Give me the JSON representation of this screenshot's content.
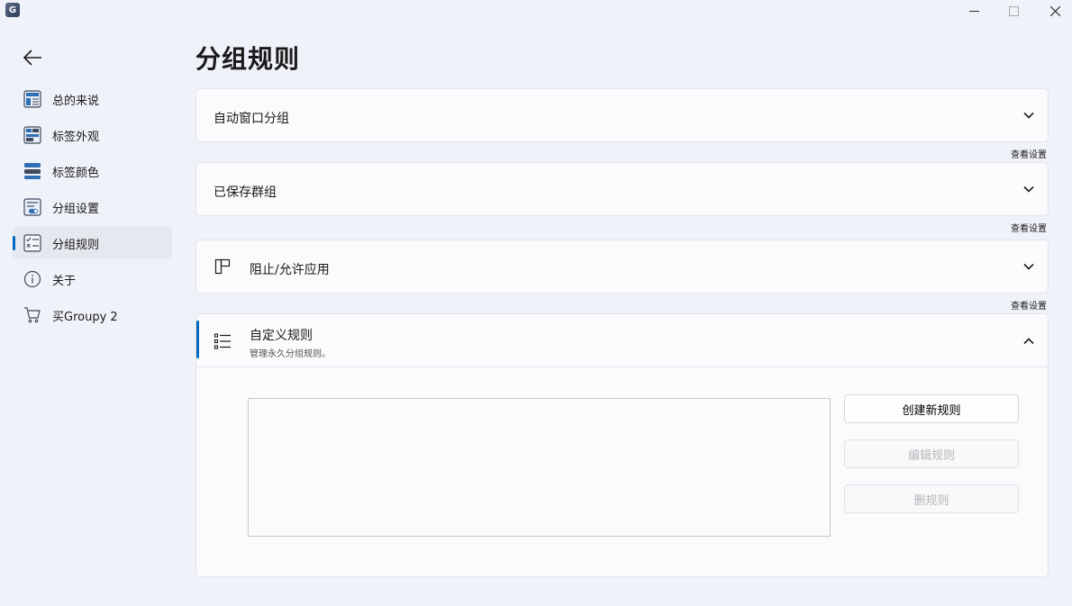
{
  "window": {
    "app_icon_letter": "G",
    "controls": {
      "minimize": "—",
      "maximize": "☐",
      "close": "✕"
    }
  },
  "sidebar": {
    "items": [
      {
        "label": "总的来说",
        "icon": "general-icon"
      },
      {
        "label": "标签外观",
        "icon": "tab-appearance-icon"
      },
      {
        "label": "标签颜色",
        "icon": "tab-color-icon"
      },
      {
        "label": "分组设置",
        "icon": "group-settings-icon"
      },
      {
        "label": "分组规则",
        "icon": "group-rules-icon",
        "active": true
      },
      {
        "label": "关于",
        "icon": "info-icon"
      },
      {
        "label": "买Groupy 2",
        "icon": "cart-icon"
      }
    ]
  },
  "page": {
    "title": "分组规则"
  },
  "sections": {
    "auto_group": {
      "label": "自动窗口分组",
      "link": "查看设置"
    },
    "saved_groups": {
      "label": "已保存群组",
      "link": "查看设置"
    },
    "block_allow": {
      "label": "阻止/允许应用",
      "link": "查看设置"
    },
    "custom_rules": {
      "label": "自定义规则",
      "description": "管理永久分组规则。",
      "buttons": {
        "create": "创建新规则",
        "edit": "编辑规则",
        "delete": "删规则"
      }
    }
  },
  "colors": {
    "accent": "#0067c0",
    "background": "#f0f2f9",
    "card": "#fbfbfd"
  }
}
